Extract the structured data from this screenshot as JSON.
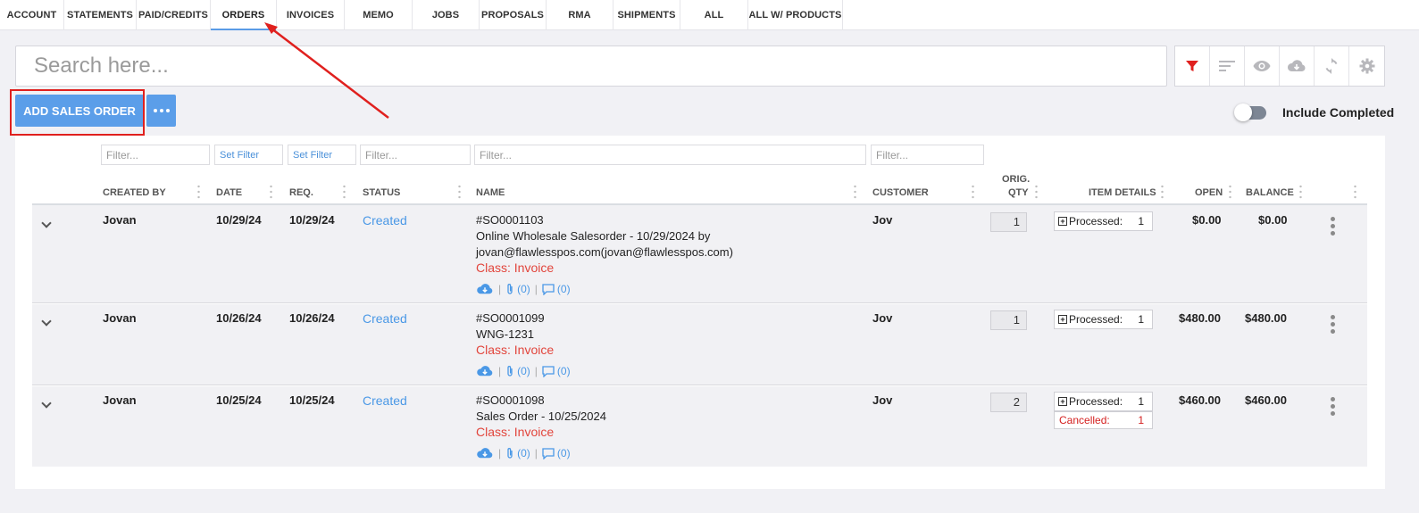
{
  "tabs": [
    "ACCOUNT",
    "STATEMENTS",
    "PAID/CREDITS",
    "ORDERS",
    "INVOICES",
    "MEMO",
    "JOBS",
    "PROPOSALS",
    "RMA",
    "SHIPMENTS",
    "ALL",
    "ALL W/ PRODUCTS"
  ],
  "active_tab": "ORDERS",
  "search": {
    "placeholder": "Search here..."
  },
  "toolbar_icons": [
    "filter-icon",
    "sort-icon",
    "eye-icon",
    "cloud-download-icon",
    "refresh-icon",
    "gear-icon"
  ],
  "colors": {
    "accent": "#5b9ee9",
    "filter_active": "#e0201e",
    "status": "#4a98e6",
    "class_text": "#e2453c",
    "annotation": "#e0201e"
  },
  "add_button": "ADD SALES ORDER",
  "include_completed": {
    "label": "Include Completed",
    "on": false
  },
  "filters": {
    "created_by": "Filter...",
    "date": "Set Filter",
    "req": "Set Filter",
    "status": "Filter...",
    "name": "Filter...",
    "customer": "Filter..."
  },
  "columns": {
    "created_by": "CREATED BY",
    "date": "DATE",
    "req": "REQ.",
    "status": "STATUS",
    "name": "NAME",
    "customer": "CUSTOMER",
    "orig": "ORIG.",
    "qty": "QTY",
    "item_details": "ITEM DETAILS",
    "open": "OPEN",
    "balance": "BALANCE"
  },
  "rows": [
    {
      "created_by": "Jovan",
      "date": "10/29/24",
      "req": "10/29/24",
      "status": "Created",
      "number": "#SO0001103",
      "name_line1": "Online Wholesale Salesorder - 10/29/2024 by",
      "name_line2": "jovan@flawlesspos.com(jovan@flawlesspos.com)",
      "class": "Class: Invoice",
      "attachments": "(0)",
      "comments": "(0)",
      "customer": "Jov",
      "qty": "1",
      "processed_label": "Processed:",
      "processed": "1",
      "open": "$0.00",
      "balance": "$0.00"
    },
    {
      "created_by": "Jovan",
      "date": "10/26/24",
      "req": "10/26/24",
      "status": "Created",
      "number": "#SO0001099",
      "name_line1": "WNG-1231",
      "class": "Class: Invoice",
      "attachments": "(0)",
      "comments": "(0)",
      "customer": "Jov",
      "qty": "1",
      "processed_label": "Processed:",
      "processed": "1",
      "open": "$480.00",
      "balance": "$480.00"
    },
    {
      "created_by": "Jovan",
      "date": "10/25/24",
      "req": "10/25/24",
      "status": "Created",
      "number": "#SO0001098",
      "name_line1": "Sales Order - 10/25/2024",
      "class": "Class: Invoice",
      "attachments": "(0)",
      "comments": "(0)",
      "customer": "Jov",
      "qty": "2",
      "processed_label": "Processed:",
      "processed": "1",
      "cancelled_label": "Cancelled:",
      "cancelled": "1",
      "open": "$460.00",
      "balance": "$460.00"
    }
  ]
}
